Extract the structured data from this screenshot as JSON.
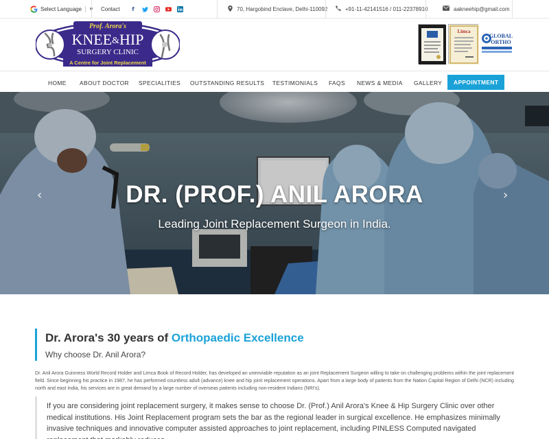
{
  "topbar": {
    "language": "Select Language",
    "lang_caret": "▼",
    "contact": "Contact",
    "social_icons": [
      "facebook-icon",
      "twitter-icon",
      "instagram-icon",
      "youtube-icon",
      "linkedin-icon"
    ],
    "address": "70, Hargobind Enclave, Delhi-110092",
    "phone": "+91-11-42141516 / 011-22378910",
    "email": "aakneehip@gmail.com"
  },
  "logo": {
    "prefix": "Prof. Arora's",
    "name_knee": "KNEE",
    "amp": "&",
    "name_hip": "HIP",
    "subtitle": "SURGERY CLINIC",
    "tagline": "A Centre for Joint Replacement"
  },
  "awards": {
    "limca_label": "Limca",
    "global_title": "GLOBAL",
    "global_sub": "ORTHO"
  },
  "nav": {
    "items": [
      "HOME",
      "ABOUT DOCTOR",
      "SPECIALITIES",
      "OUTSTANDING RESULTS",
      "TESTIMONIALS",
      "FAQS",
      "NEWS & MEDIA",
      "GALLERY"
    ],
    "appointment": "APPOINTMENT"
  },
  "hero": {
    "title": "DR. (PROF.) ANIL ARORA",
    "subtitle": "Leading Joint Replacement Surgeon in India.",
    "prev": "‹",
    "next": "›"
  },
  "intro": {
    "heading_plain": "Dr. Arora's 30 years of ",
    "heading_accent": "Orthopaedic Excellence",
    "subheading": "Why choose Dr. Anil Arora?"
  },
  "paragraph": "Dr. Anil Arora Guinness World Record Holder and Limca Book of Record Holder, has developed an unenviable reputation as an joint Replacement Surgeon willing to take on challenging problems within the joint replacement field. Since beginning his practice in 1987, he has performed countless adult (advance) knee and hip joint replacement operations. Apart from a large body of patients from the Nation Capital Region of Delhi (NCR) including north and east India, his services are in great demand by a large number of overseas patients including non-resident Indians (NRI's).",
  "quote": "If you are considering joint replacement surgery, it makes sense to choose Dr. (Prof.) Anil Arora's Knee & Hip Surgery Clinic over other medical institutions. His Joint Replacement program sets the bar as the regional leader in surgical excellence. He emphasizes minimally invasive techniques and innovative computer assisted approaches to joint replacement, including PINLESS Computed navigated replacement that markably reduces"
}
